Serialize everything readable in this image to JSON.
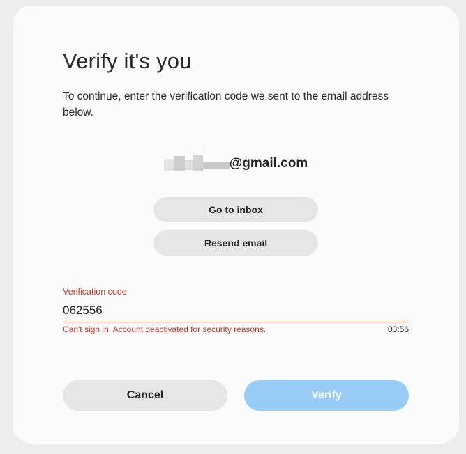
{
  "title": "Verify it's you",
  "description": "To continue, enter the verification code we sent to the email address below.",
  "email": {
    "domain": "@gmail.com"
  },
  "buttons": {
    "go_to_inbox": "Go to inbox",
    "resend_email": "Resend email",
    "cancel": "Cancel",
    "verify": "Verify"
  },
  "verification": {
    "label": "Verification code",
    "value": "062556",
    "error": "Can't sign in. Account deactivated for security reasons.",
    "timer": "03:56"
  },
  "colors": {
    "error": "#c0392b",
    "verify_disabled": "#99cbf7",
    "secondary_button": "#e6e6e6"
  }
}
